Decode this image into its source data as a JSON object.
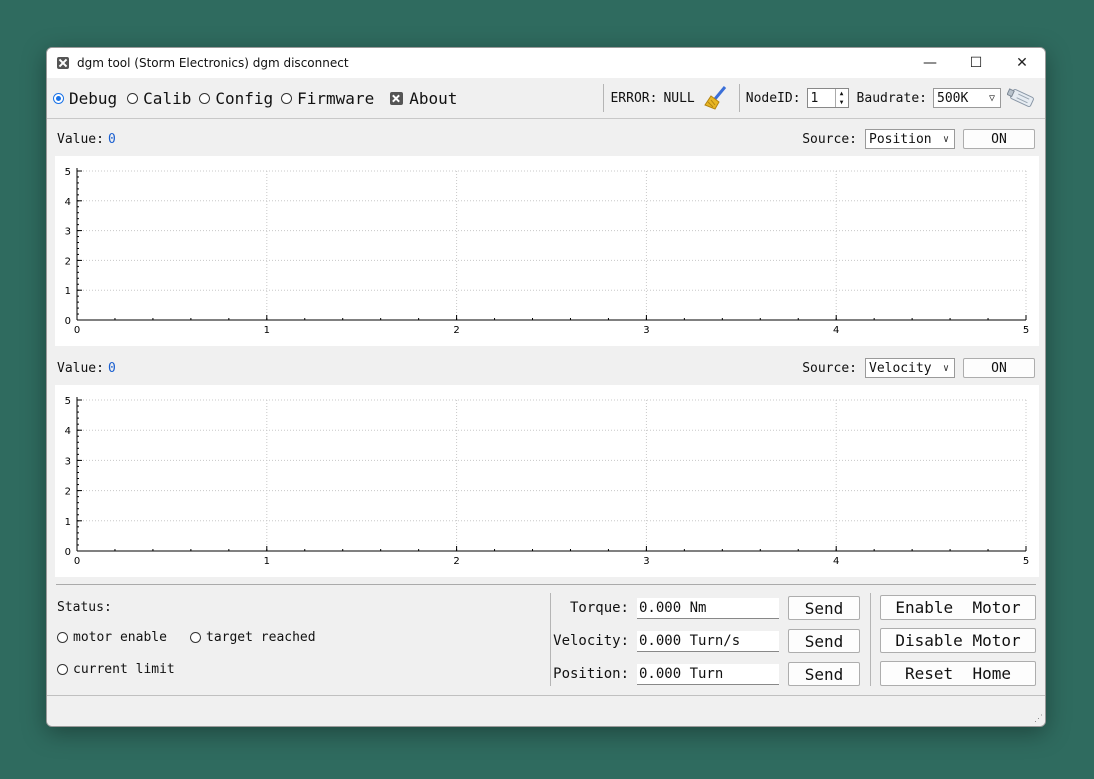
{
  "window": {
    "title": "dgm tool (Storm Electronics)  dgm disconnect"
  },
  "toolbar": {
    "modes": [
      {
        "label": "Debug",
        "selected": true
      },
      {
        "label": "Calib",
        "selected": false
      },
      {
        "label": "Config",
        "selected": false
      },
      {
        "label": "Firmware",
        "selected": false
      }
    ],
    "about_label": "About",
    "error_label": "ERROR:",
    "error_value": "NULL",
    "nodeid_label": "NodeID:",
    "nodeid_value": "1",
    "baudrate_label": "Baudrate:",
    "baudrate_value": "500K"
  },
  "panel1": {
    "value_label": "Value:",
    "value": "0",
    "source_label": "Source:",
    "source_value": "Position",
    "on_label": "ON"
  },
  "panel2": {
    "value_label": "Value:",
    "value": "0",
    "source_label": "Source:",
    "source_value": "Velocity",
    "on_label": "ON"
  },
  "chart_data": [
    {
      "type": "line",
      "series": [],
      "xlim": [
        0,
        5
      ],
      "ylim": [
        0,
        5
      ],
      "xticks": [
        "0",
        "1",
        "2",
        "3",
        "4",
        "5"
      ],
      "yticks": [
        "0",
        "1",
        "2",
        "3",
        "4",
        "5"
      ],
      "grid": true
    },
    {
      "type": "line",
      "series": [],
      "xlim": [
        0,
        5
      ],
      "ylim": [
        0,
        5
      ],
      "xticks": [
        "0",
        "1",
        "2",
        "3",
        "4",
        "5"
      ],
      "yticks": [
        "0",
        "1",
        "2",
        "3",
        "4",
        "5"
      ],
      "grid": true
    }
  ],
  "status": {
    "title": "Status:",
    "motor_enable": "motor enable",
    "target_reached": "target reached",
    "current_limit": "current limit"
  },
  "commands": [
    {
      "label": "Torque:",
      "value": "0.000 Nm",
      "send": "Send"
    },
    {
      "label": "Velocity:",
      "value": "0.000 Turn/s",
      "send": "Send"
    },
    {
      "label": "Position:",
      "value": "0.000 Turn",
      "send": "Send"
    }
  ],
  "actions": {
    "enable": "Enable  Motor",
    "disable": "Disable Motor",
    "reset": "Reset  Home"
  }
}
